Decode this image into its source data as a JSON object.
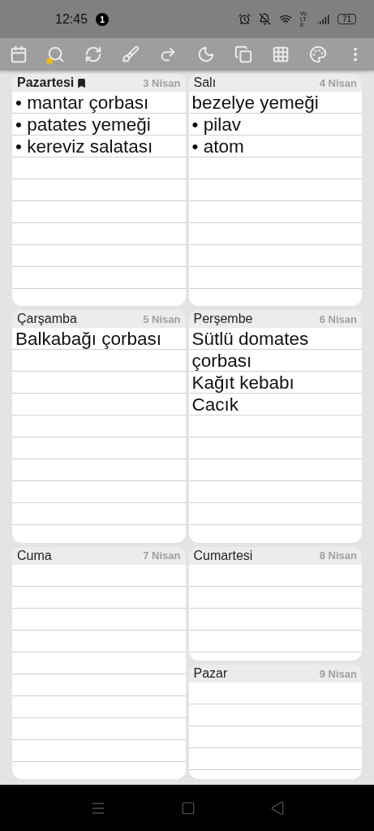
{
  "status_bar": {
    "time": "12:45",
    "notification_count": "1",
    "network": "Vo LTE",
    "battery": "71"
  },
  "days": [
    {
      "name": "Pazartesi",
      "date": "3 Nisan",
      "today": true,
      "entries": [
        "• mantar çorbası",
        "• patates yemeği",
        "• kereviz salatası"
      ]
    },
    {
      "name": "Salı",
      "date": "4 Nisan",
      "today": false,
      "entries": [
        "bezelye yemeği",
        "• pilav",
        "• atom"
      ]
    },
    {
      "name": "Çarşamba",
      "date": "5 Nisan",
      "today": false,
      "entries": [
        "Balkabağı çorbası"
      ]
    },
    {
      "name": "Perşembe",
      "date": "6 Nisan",
      "today": false,
      "entries": [
        "Sütlü domates çorbası",
        "Kağıt kebabı",
        "Cacık"
      ]
    },
    {
      "name": "Cuma",
      "date": "7 Nisan",
      "today": false
    },
    {
      "name": "Cumartesi",
      "date": "8 Nisan",
      "today": false
    },
    {
      "name": "Pazar",
      "date": "9 Nisan",
      "today": false
    }
  ]
}
